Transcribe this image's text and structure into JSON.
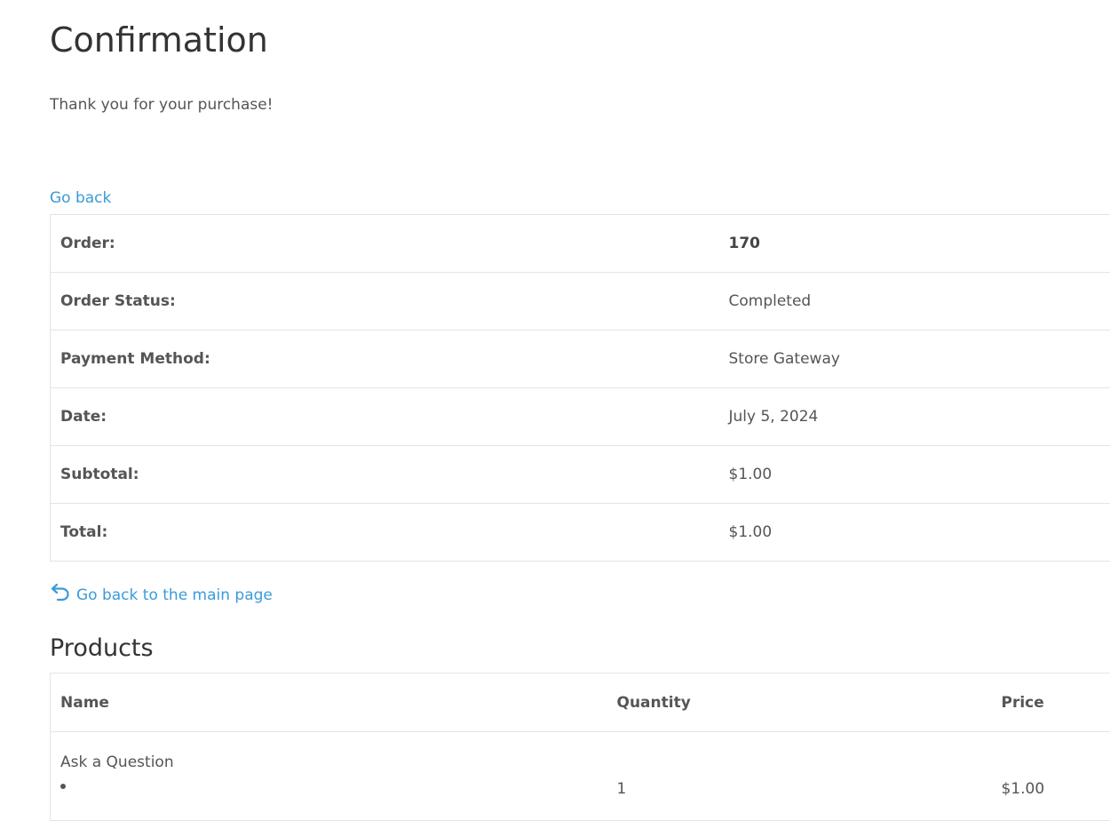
{
  "page": {
    "title": "Confirmation",
    "thanks_message": "Thank you for your purchase!",
    "go_back_label": "Go back"
  },
  "order": {
    "rows": [
      {
        "label": "Order:",
        "value": "170"
      },
      {
        "label": "Order Status:",
        "value": "Completed"
      },
      {
        "label": "Payment Method:",
        "value": "Store Gateway"
      },
      {
        "label": "Date:",
        "value": "July 5, 2024"
      },
      {
        "label": "Subtotal:",
        "value": "$1.00"
      },
      {
        "label": "Total:",
        "value": "$1.00"
      }
    ]
  },
  "main_page_link": {
    "label": "Go back to the main page",
    "icon": "undo-arrow-icon"
  },
  "products": {
    "title": "Products",
    "columns": [
      "Name",
      "Quantity",
      "Price"
    ],
    "rows": [
      {
        "name": "Ask a Question",
        "quantity": "1",
        "price": "$1.00"
      }
    ]
  },
  "colors": {
    "link": "#3a9bd9",
    "text": "#555555",
    "heading": "#333333",
    "border": "#e4e4e4"
  }
}
